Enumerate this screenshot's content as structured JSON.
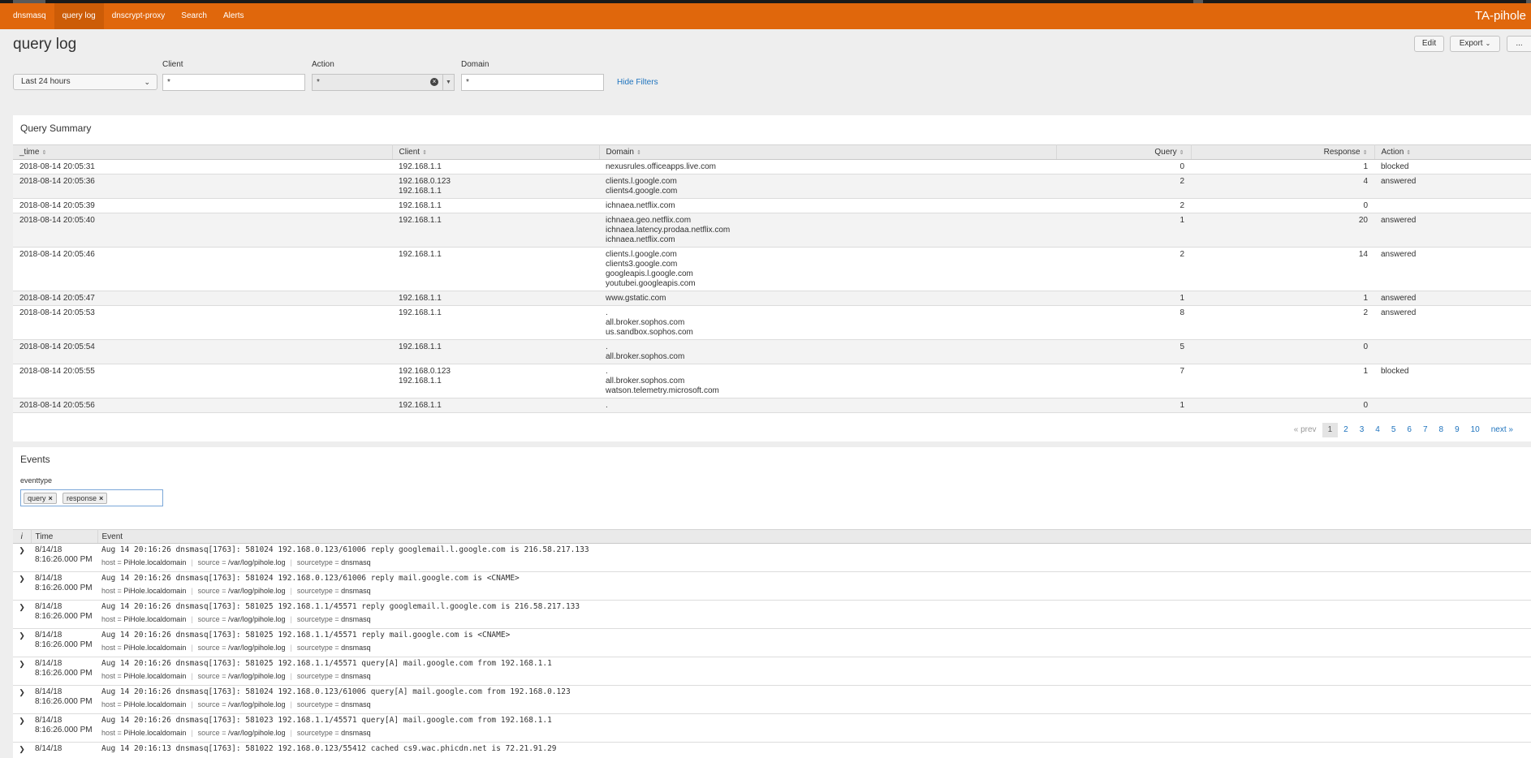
{
  "app": {
    "name": "TA-pihole",
    "nav": [
      "dnsmasq",
      "query log",
      "dnscrypt-proxy",
      "Search",
      "Alerts"
    ],
    "active_nav": "query log"
  },
  "page": {
    "title": "query log",
    "edit_label": "Edit",
    "export_label": "Export",
    "more_label": "..."
  },
  "filters": {
    "time_range": "Last 24 hours",
    "client_label": "Client",
    "client_value": "*",
    "action_label": "Action",
    "action_value": "*",
    "domain_label": "Domain",
    "domain_value": "*",
    "hide_filters_label": "Hide Filters"
  },
  "summary": {
    "title": "Query Summary",
    "columns": [
      "_time",
      "Client",
      "Domain",
      "Query",
      "Response",
      "Action"
    ],
    "rows": [
      {
        "time": "2018-08-14 20:05:31",
        "clients": [
          "192.168.1.1"
        ],
        "domains": [
          "nexusrules.officeapps.live.com"
        ],
        "query": "0",
        "response": "1",
        "action": "blocked"
      },
      {
        "time": "2018-08-14 20:05:36",
        "clients": [
          "192.168.0.123",
          "192.168.1.1"
        ],
        "domains": [
          "clients.l.google.com",
          "clients4.google.com"
        ],
        "query": "2",
        "response": "4",
        "action": "answered"
      },
      {
        "time": "2018-08-14 20:05:39",
        "clients": [
          "192.168.1.1"
        ],
        "domains": [
          "ichnaea.netflix.com"
        ],
        "query": "2",
        "response": "0",
        "action": ""
      },
      {
        "time": "2018-08-14 20:05:40",
        "clients": [
          "192.168.1.1"
        ],
        "domains": [
          "ichnaea.geo.netflix.com",
          "ichnaea.latency.prodaa.netflix.com",
          "ichnaea.netflix.com"
        ],
        "query": "1",
        "response": "20",
        "action": "answered"
      },
      {
        "time": "2018-08-14 20:05:46",
        "clients": [
          "192.168.1.1"
        ],
        "domains": [
          "clients.l.google.com",
          "clients3.google.com",
          "googleapis.l.google.com",
          "youtubei.googleapis.com"
        ],
        "query": "2",
        "response": "14",
        "action": "answered"
      },
      {
        "time": "2018-08-14 20:05:47",
        "clients": [
          "192.168.1.1"
        ],
        "domains": [
          "www.gstatic.com"
        ],
        "query": "1",
        "response": "1",
        "action": "answered"
      },
      {
        "time": "2018-08-14 20:05:53",
        "clients": [
          "192.168.1.1"
        ],
        "domains": [
          ".",
          "all.broker.sophos.com",
          "us.sandbox.sophos.com"
        ],
        "query": "8",
        "response": "2",
        "action": "answered"
      },
      {
        "time": "2018-08-14 20:05:54",
        "clients": [
          "192.168.1.1"
        ],
        "domains": [
          ".",
          "all.broker.sophos.com"
        ],
        "query": "5",
        "response": "0",
        "action": ""
      },
      {
        "time": "2018-08-14 20:05:55",
        "clients": [
          "192.168.0.123",
          "192.168.1.1"
        ],
        "domains": [
          ".",
          "all.broker.sophos.com",
          "watson.telemetry.microsoft.com"
        ],
        "query": "7",
        "response": "1",
        "action": "blocked"
      },
      {
        "time": "2018-08-14 20:05:56",
        "clients": [
          "192.168.1.1"
        ],
        "domains": [
          "."
        ],
        "query": "1",
        "response": "0",
        "action": ""
      }
    ]
  },
  "pagination": {
    "prev": "« prev",
    "pages": [
      "1",
      "2",
      "3",
      "4",
      "5",
      "6",
      "7",
      "8",
      "9",
      "10"
    ],
    "current": "1",
    "next": "next »"
  },
  "events": {
    "title": "Events",
    "eventtype_label": "eventtype",
    "tokens": [
      "query",
      "response"
    ],
    "columns": [
      "i",
      "Time",
      "Event"
    ],
    "meta_labels": {
      "host": "host",
      "source": "source",
      "sourcetype": "sourcetype"
    },
    "rows": [
      {
        "date": "8/14/18",
        "time": "8:16:26.000 PM",
        "raw": "Aug 14 20:16:26 dnsmasq[1763]: 581024 192.168.0.123/61006 reply googlemail.l.google.com is 216.58.217.133",
        "host": "PiHole.localdomain",
        "source": "/var/log/pihole.log",
        "sourcetype": "dnsmasq"
      },
      {
        "date": "8/14/18",
        "time": "8:16:26.000 PM",
        "raw": "Aug 14 20:16:26 dnsmasq[1763]: 581024 192.168.0.123/61006 reply mail.google.com is <CNAME>",
        "host": "PiHole.localdomain",
        "source": "/var/log/pihole.log",
        "sourcetype": "dnsmasq"
      },
      {
        "date": "8/14/18",
        "time": "8:16:26.000 PM",
        "raw": "Aug 14 20:16:26 dnsmasq[1763]: 581025 192.168.1.1/45571 reply googlemail.l.google.com is 216.58.217.133",
        "host": "PiHole.localdomain",
        "source": "/var/log/pihole.log",
        "sourcetype": "dnsmasq"
      },
      {
        "date": "8/14/18",
        "time": "8:16:26.000 PM",
        "raw": "Aug 14 20:16:26 dnsmasq[1763]: 581025 192.168.1.1/45571 reply mail.google.com is <CNAME>",
        "host": "PiHole.localdomain",
        "source": "/var/log/pihole.log",
        "sourcetype": "dnsmasq"
      },
      {
        "date": "8/14/18",
        "time": "8:16:26.000 PM",
        "raw": "Aug 14 20:16:26 dnsmasq[1763]: 581025 192.168.1.1/45571 query[A] mail.google.com from 192.168.1.1",
        "host": "PiHole.localdomain",
        "source": "/var/log/pihole.log",
        "sourcetype": "dnsmasq"
      },
      {
        "date": "8/14/18",
        "time": "8:16:26.000 PM",
        "raw": "Aug 14 20:16:26 dnsmasq[1763]: 581024 192.168.0.123/61006 query[A] mail.google.com from 192.168.0.123",
        "host": "PiHole.localdomain",
        "source": "/var/log/pihole.log",
        "sourcetype": "dnsmasq"
      },
      {
        "date": "8/14/18",
        "time": "8:16:26.000 PM",
        "raw": "Aug 14 20:16:26 dnsmasq[1763]: 581023 192.168.1.1/45571 query[A] mail.google.com from 192.168.1.1",
        "host": "PiHole.localdomain",
        "source": "/var/log/pihole.log",
        "sourcetype": "dnsmasq"
      },
      {
        "date": "8/14/18",
        "time": "",
        "raw": "Aug 14 20:16:13 dnsmasq[1763]: 581022 192.168.0.123/55412 cached cs9.wac.phicdn.net is 72.21.91.29",
        "host": "",
        "source": "",
        "sourcetype": ""
      }
    ]
  },
  "colors": {
    "accent": "#e0670c",
    "link": "#1e73be",
    "topstrip": "#1a1a1a"
  }
}
